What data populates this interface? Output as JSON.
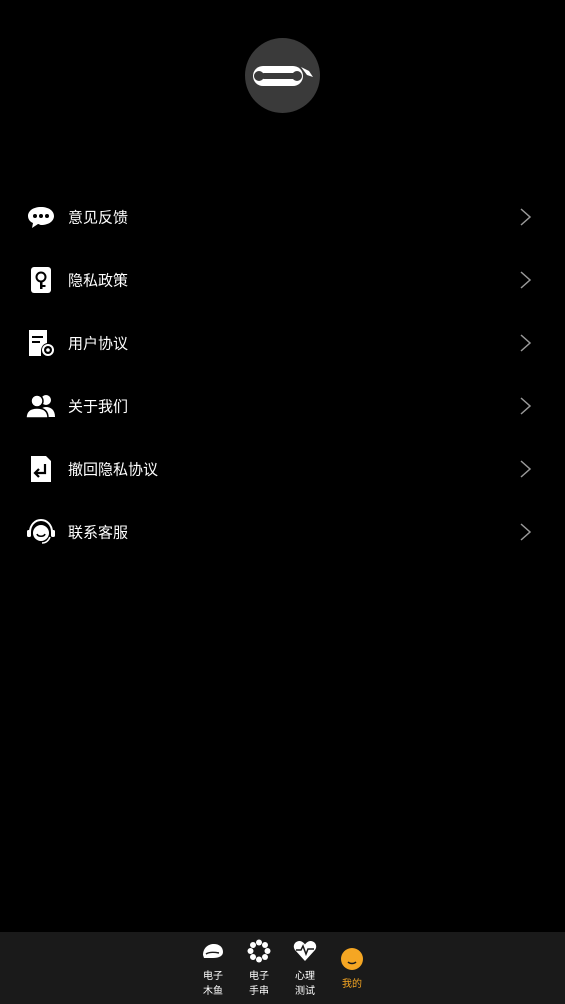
{
  "profile": {
    "avatar_icon": "link-avatar-icon"
  },
  "menu": {
    "items": [
      {
        "label": "意见反馈",
        "icon": "chat-bubble-icon"
      },
      {
        "label": "隐私政策",
        "icon": "privacy-lock-icon"
      },
      {
        "label": "用户协议",
        "icon": "document-gear-icon"
      },
      {
        "label": "关于我们",
        "icon": "users-icon"
      },
      {
        "label": "撤回隐私协议",
        "icon": "document-return-icon"
      },
      {
        "label": "联系客服",
        "icon": "headset-icon"
      }
    ],
    "chevron_icon": "chevron-right-icon"
  },
  "tabbar": {
    "tabs": [
      {
        "line1": "电子",
        "line2": "木鱼",
        "icon": "wooden-fish-icon"
      },
      {
        "line1": "电子",
        "line2": "手串",
        "icon": "bead-bracelet-icon"
      },
      {
        "line1": "心理",
        "line2": "测试",
        "icon": "heart-pulse-icon"
      },
      {
        "label": "我的",
        "icon": "smiley-face-icon",
        "active": true
      }
    ],
    "active_color": "#f5a623",
    "inactive_color": "#ffffff"
  },
  "colors": {
    "background": "#000000",
    "tabbar_background": "#1a1a1a",
    "avatar_background": "#3a3a3a"
  }
}
